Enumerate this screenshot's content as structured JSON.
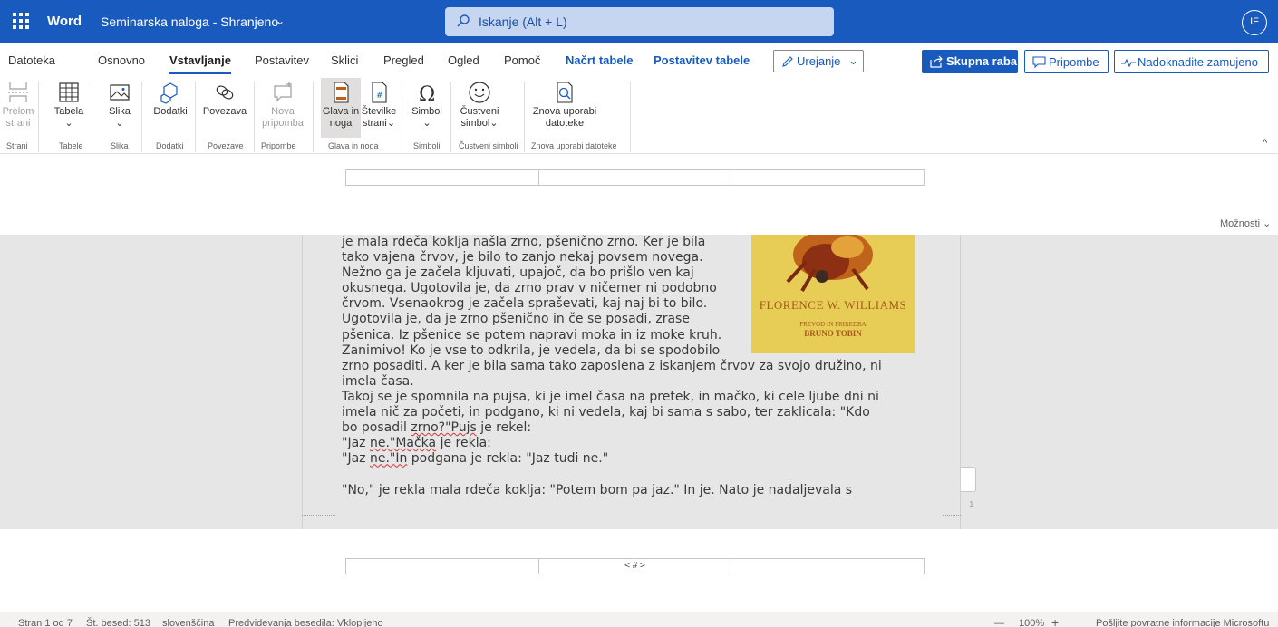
{
  "titlebar": {
    "app_name": "Word",
    "doc_title": "Seminarska naloga - Shranjeno",
    "search_text": "Iskanje (Alt + L)",
    "avatar_initials": "IF",
    "accent": "#185abd"
  },
  "tabs": [
    {
      "label": "Datoteka"
    },
    {
      "label": "Osnovno"
    },
    {
      "label": "Vstavljanje"
    },
    {
      "label": "Postavitev"
    },
    {
      "label": "Sklici"
    },
    {
      "label": "Pregled"
    },
    {
      "label": "Ogled"
    },
    {
      "label": "Pomoč"
    },
    {
      "label": "Načrt tabele"
    },
    {
      "label": "Postavitev tabele"
    }
  ],
  "actions": {
    "edit_mode": "Urejanje",
    "share": "Skupna raba",
    "comments": "Pripombe",
    "catch_up": "Nadoknadite zamujeno"
  },
  "ribbon": {
    "buttons": [
      {
        "label1": "Prelom",
        "label2": "strani",
        "icon": "page-break-icon"
      },
      {
        "label1": "Tabela",
        "label2": "⌄",
        "icon": "table-icon"
      },
      {
        "label1": "Slika",
        "label2": "⌄",
        "icon": "picture-icon"
      },
      {
        "label1": "Dodatki",
        "label2": "",
        "icon": "add-ins-icon"
      },
      {
        "label1": "Povezava",
        "label2": "",
        "icon": "link-icon"
      },
      {
        "label1": "Nova",
        "label2": "pripomba",
        "icon": "comment-icon"
      },
      {
        "label1": "Glava in",
        "label2": "noga",
        "icon": "header-footer-icon"
      },
      {
        "label1": "Številke",
        "label2": "strani⌄",
        "icon": "page-number-icon"
      },
      {
        "label1": "Simbol",
        "label2": "⌄",
        "icon": "omega-icon"
      },
      {
        "label1": "Čustveni",
        "label2": "simbol⌄",
        "icon": "emoji-icon"
      },
      {
        "label1": "Znova uporabi",
        "label2": "datoteke",
        "icon": "reuse-files-icon"
      }
    ],
    "groups": [
      "Strani",
      "Tabele",
      "Slika",
      "Dodatki",
      "Povezave",
      "Pripombe",
      "Glava in noga",
      "Simboli",
      "Čustveni simboli",
      "Znova uporabi datoteke"
    ]
  },
  "canvas": {
    "options_label": "Možnosti",
    "footer_field": "< # >",
    "page_number": "1",
    "lines": [
      "je mala rdeča koklja našla zrno, pšenično zrno. Ker je bila",
      "tako vajena črvov, je bilo to zanjo nekaj povsem novega.",
      "Nežno ga je začela kljuvati, upajoč, da bo prišlo ven kaj",
      "okusnega. Ugotovila je, da zrno prav v ničemer ni podobno",
      "črvom. Vsenaokrog je začela spraševati, kaj naj bi to bilo.",
      "Ugotovila je, da je zrno pšenično in če se posadi, zrase",
      "pšenica. Iz pšenice se potem napravi moka in iz moke kruh.",
      "Zanimivo! Ko je vse to odkrila, je vedela, da bi se spodobilo",
      "zrno posaditi. A ker je bila sama tako zaposlena z iskanjem črvov za svojo družino, ni",
      "imela časa.",
      "Takoj se je spomnila na pujsa, ki je imel časa na pretek, in mačko, ki cele ljube dni ni",
      "imela nič za početi, in podgano, ki ni vedela, kaj bi sama s sabo, ter zaklicala: \"Kdo"
    ],
    "line_zrno_a": "bo posadil ",
    "line_zrno_b": "zrno?\"Pujs",
    "line_zrno_c": " je rekel:",
    "line_macka_a": "\"Jaz ",
    "line_macka_b": "ne.\"Mačka",
    "line_macka_c": " je rekla:",
    "line_in_a": "\"Jaz ",
    "line_in_b": "ne.\"In",
    "line_in_c": " podgana je rekla: \"Jaz tudi ne.\"",
    "line_last": "\"No,\" je rekla mala rdeča koklja: \"Potem bom pa jaz.\" In je. Nato je nadaljevala s",
    "cover": {
      "author": "FLORENCE W. WILLIAMS",
      "subtitle": "PREVOD IN PRIREDBA",
      "translator": "BRUNO TOBIN",
      "color": "#e7cd56"
    }
  },
  "status": {
    "page": "Stran 1 od 7",
    "words": "Št. besed: 513",
    "language": "slovenščina",
    "predictions": "Predvidevanja besedila: Vklopljeno",
    "zoom_out": "—",
    "zoom": "100%",
    "zoom_in": "+",
    "feedback": "Pošljite povratne informacije Microsoftu"
  }
}
